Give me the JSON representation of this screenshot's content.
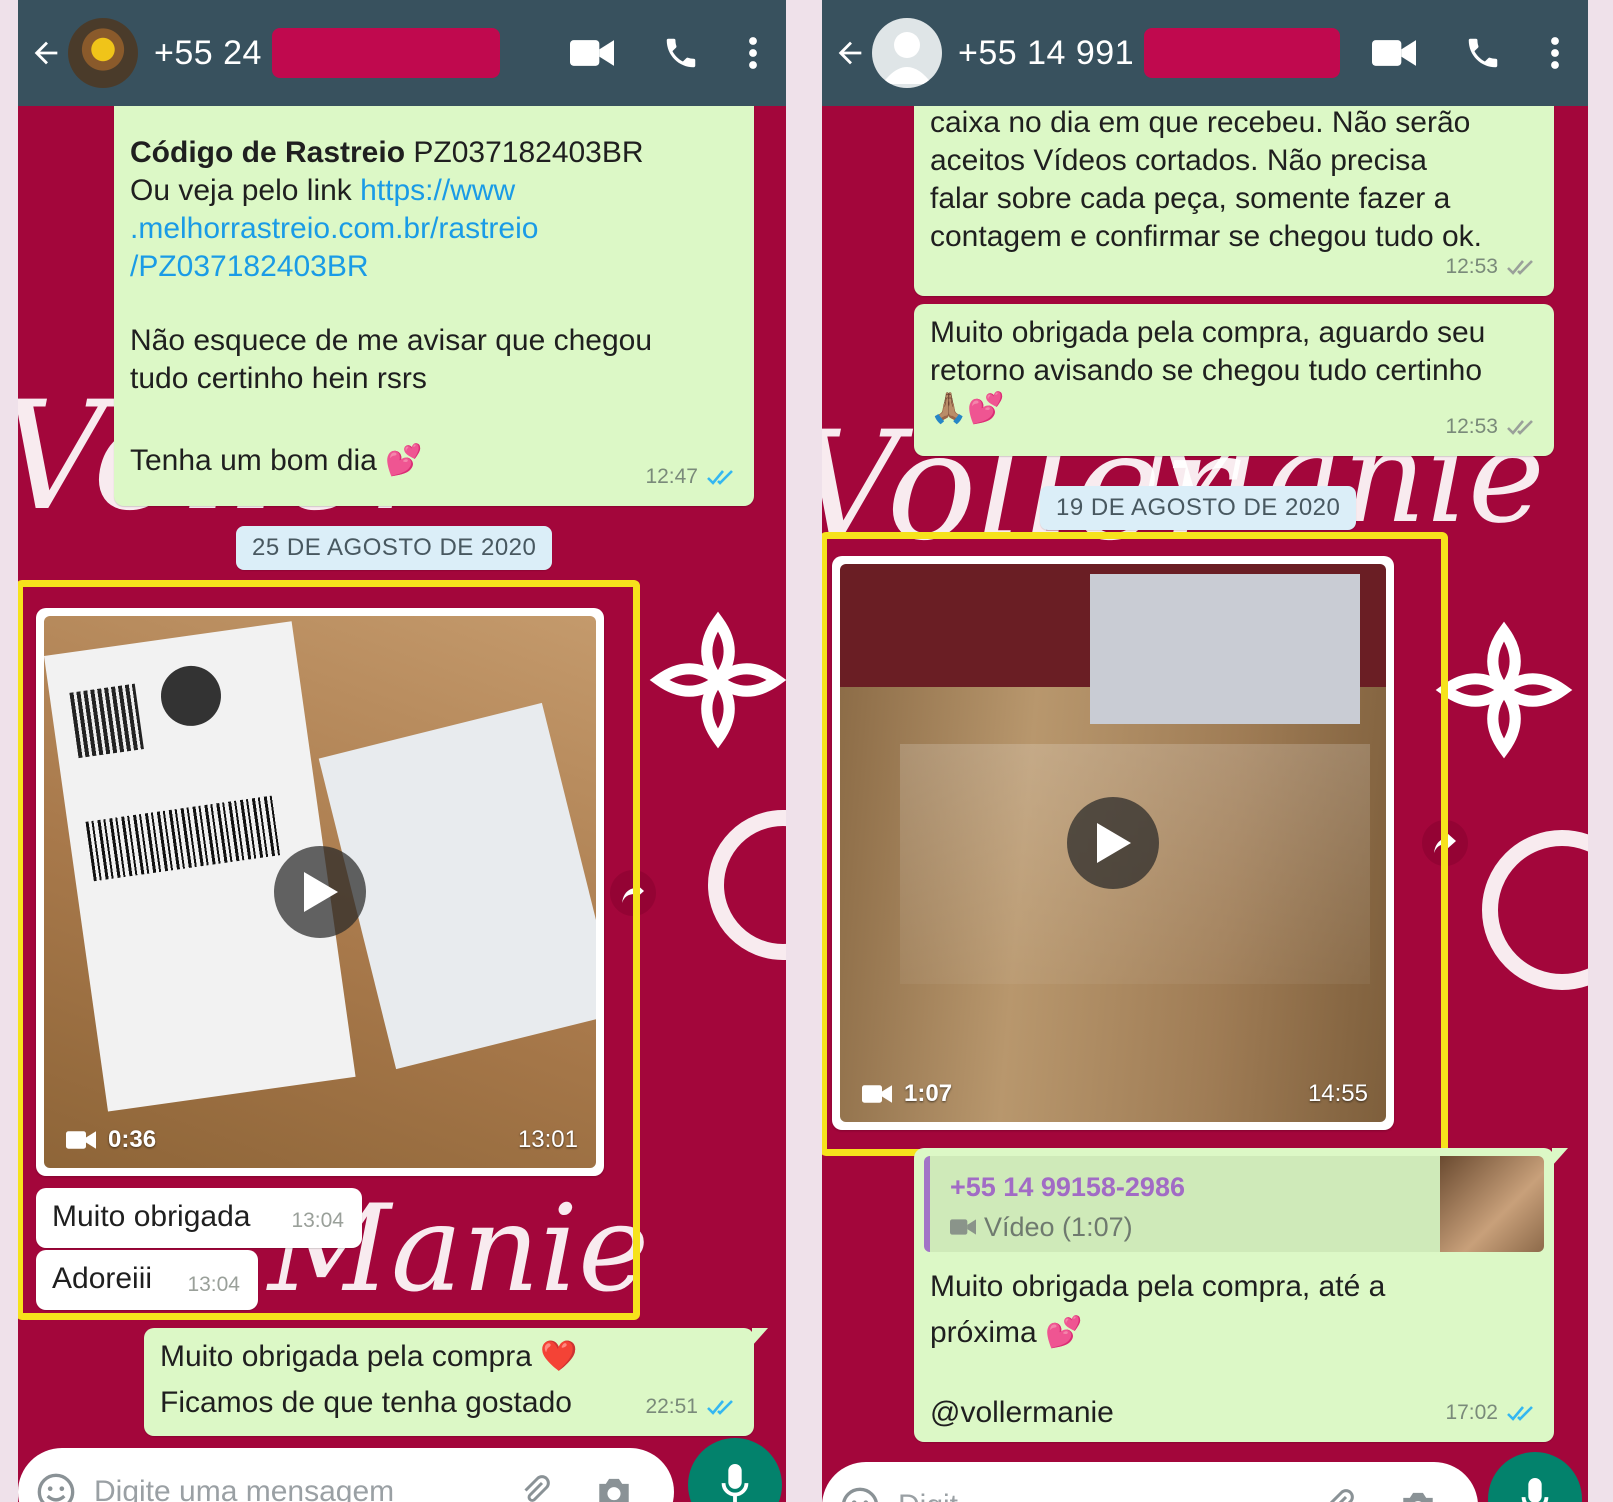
{
  "left": {
    "header": {
      "phone": "+55 24"
    },
    "messages": {
      "tracking_label": "Código de Rastreio",
      "tracking_code": "PZ037182403BR",
      "link_prefix": "Ou veja pelo link",
      "link_line1": "https://www",
      "link_line2": ".melhorrastreio.com.br/rastreio",
      "link_line3": "/PZ037182403BR",
      "reminder_line1": "Não esquece de me avisar que chegou",
      "reminder_line2": "tudo certinho hein rsrs",
      "greeting": "Tenha um bom dia",
      "greeting_emoji": "💕",
      "greeting_time": "12:47"
    },
    "date_pill": "25 DE AGOSTO DE 2020",
    "video": {
      "duration": "0:36",
      "time": "13:01"
    },
    "reply1": {
      "text": "Muito obrigada",
      "time": "13:04"
    },
    "reply2": {
      "text": "Adoreiii",
      "time": "13:04"
    },
    "final": {
      "line1": "Muito obrigada pela compra",
      "line1_emoji": "❤️",
      "line2": "Ficamos de que tenha gostado",
      "time": "22:51"
    },
    "input_placeholder": "Digite uma mensagem"
  },
  "right": {
    "header": {
      "phone": "+55 14 991"
    },
    "messages": {
      "top_line1": "caixa no dia em que recebeu. Não serão",
      "top_line2": "aceitos Vídeos cortados. Não precisa",
      "top_line3": "falar sobre cada peça, somente fazer a",
      "top_line4": "contagem e confirmar se chegou tudo ok.",
      "top_time": "12:53",
      "thanks_line1": "Muito obrigada pela compra, aguardo seu",
      "thanks_line2": "retorno avisando se chegou tudo certinho",
      "thanks_emoji": "🙏🏽💕",
      "thanks_time": "12:53"
    },
    "date_pill": "19 DE AGOSTO DE 2020",
    "video": {
      "duration": "1:07",
      "time": "14:55"
    },
    "quoted": {
      "name": "+55 14 99158-2986",
      "type": "Vídeo (1:07)"
    },
    "final": {
      "line1": "Muito obrigada pela compra, até a",
      "line2": "próxima",
      "line2_emoji": "💕",
      "handle": "@vollermanie",
      "time": "17:02"
    },
    "input_placeholder": "Digit"
  },
  "wallpaper": {
    "brand_script_1": "Voller",
    "brand_script_2": "Manie"
  },
  "colors": {
    "header": "#38515e",
    "wallpaper": "#a3063b",
    "outgoing_bubble": "#dcf8c6",
    "incoming_bubble": "#ffffff",
    "highlight": "#f6e21c",
    "redaction": "#c0094e",
    "link": "#1a9be6",
    "read_ticks": "#34b7f1",
    "mic_button": "#03826c"
  }
}
